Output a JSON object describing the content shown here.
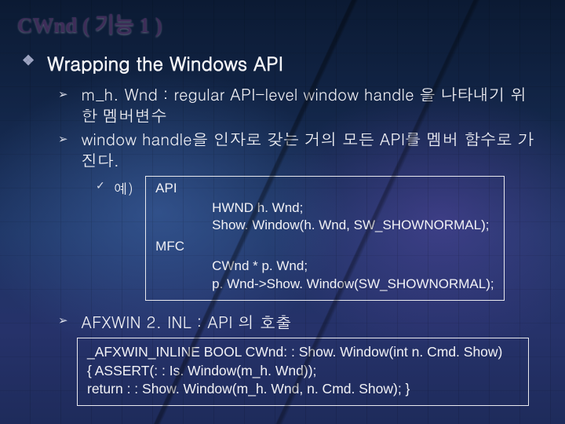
{
  "title": "CWnd ( 기능 1 )",
  "heading": "Wrapping the Windows API",
  "bullets": {
    "diamond": "❖",
    "arrow": "➢",
    "check": "✓"
  },
  "items": [
    "m_h. Wnd : regular API-level window handle 을 나타내기 위한 멤버변수",
    "window handle을 인자로 갖는 거의 모든 API를 멤버 함수로 가진다."
  ],
  "example_label": "예)",
  "codebox": {
    "api_label": "API",
    "api_lines": [
      "HWND h. Wnd;",
      "Show. Window(h. Wnd, SW_SHOWNORMAL);"
    ],
    "mfc_label": "MFC",
    "mfc_lines": [
      "CWnd * p. Wnd;",
      "p. Wnd->Show. Window(SW_SHOWNORMAL);"
    ]
  },
  "item3": "AFXWIN 2. INL  : API 의 호출",
  "codebox2": [
    "_AFXWIN_INLINE BOOL CWnd: : Show. Window(int n. Cmd. Show)",
    "{ ASSERT(: : Is. Window(m_h. Wnd));",
    "return : : Show. Window(m_h. Wnd, n. Cmd. Show); }"
  ]
}
